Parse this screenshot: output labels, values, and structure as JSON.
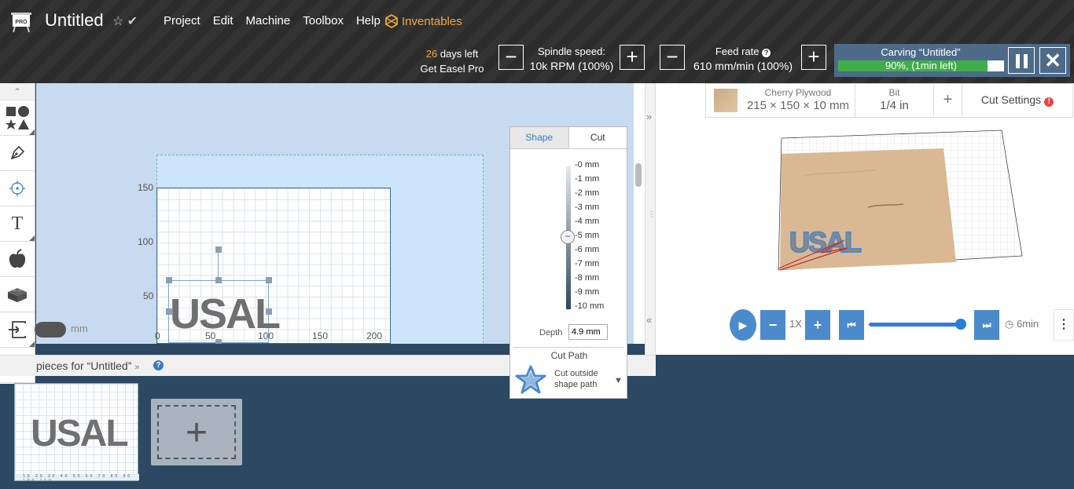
{
  "header": {
    "badge": "PRO",
    "title": "Untitled",
    "menu": [
      "Project",
      "Edit",
      "Machine",
      "Toolbox",
      "Help"
    ],
    "inventables": "Inventables",
    "trial": {
      "days": "26",
      "days_suffix": " days left",
      "cta": "Get Easel Pro"
    },
    "spindle": {
      "label": "Spindle speed:",
      "value": "10k RPM (100%)"
    },
    "feed": {
      "label": "Feed rate",
      "value": "610 mm/min (100%)"
    },
    "carving": {
      "title": "Carving “Untitled”",
      "progress_text": "90%, (1min left)",
      "progress": 0.9
    }
  },
  "canvas": {
    "y_ticks": [
      "150",
      "100",
      "50"
    ],
    "x_ticks": [
      "0",
      "50",
      "100",
      "150",
      "200"
    ],
    "design_text": "USAL",
    "unit_label": "mm"
  },
  "cut_panel": {
    "tabs": [
      "Shape",
      "Cut"
    ],
    "depth_ticks": [
      "-0 mm",
      "-1 mm",
      "-2 mm",
      "-3 mm",
      "-4 mm",
      "-5 mm",
      "-6 mm",
      "-7 mm",
      "-8 mm",
      "-9 mm",
      "-10 mm"
    ],
    "depth_label": "Depth",
    "depth_value": "4.9 mm",
    "cut_path_label": "Cut Path",
    "cut_type": "Cut outside shape path"
  },
  "material": {
    "name": "Cherry Plywood",
    "dims": "215 × 150 × 10 mm",
    "bit_label": "Bit",
    "bit_value": "1/4 in",
    "cut_settings": "Cut Settings"
  },
  "simulation": {
    "speed": "1X",
    "time": "6min"
  },
  "workpieces": {
    "title": "pieces for “Untitled”",
    "thumb_text": "USAL",
    "thumb_ruler": "10 20 30 40 50 60 70 80 90 100 110"
  },
  "colors": {
    "accent": "#f1a73c",
    "primary": "#4c8bcb",
    "topbar": "#2e2e2e",
    "footer": "#2c4862"
  }
}
